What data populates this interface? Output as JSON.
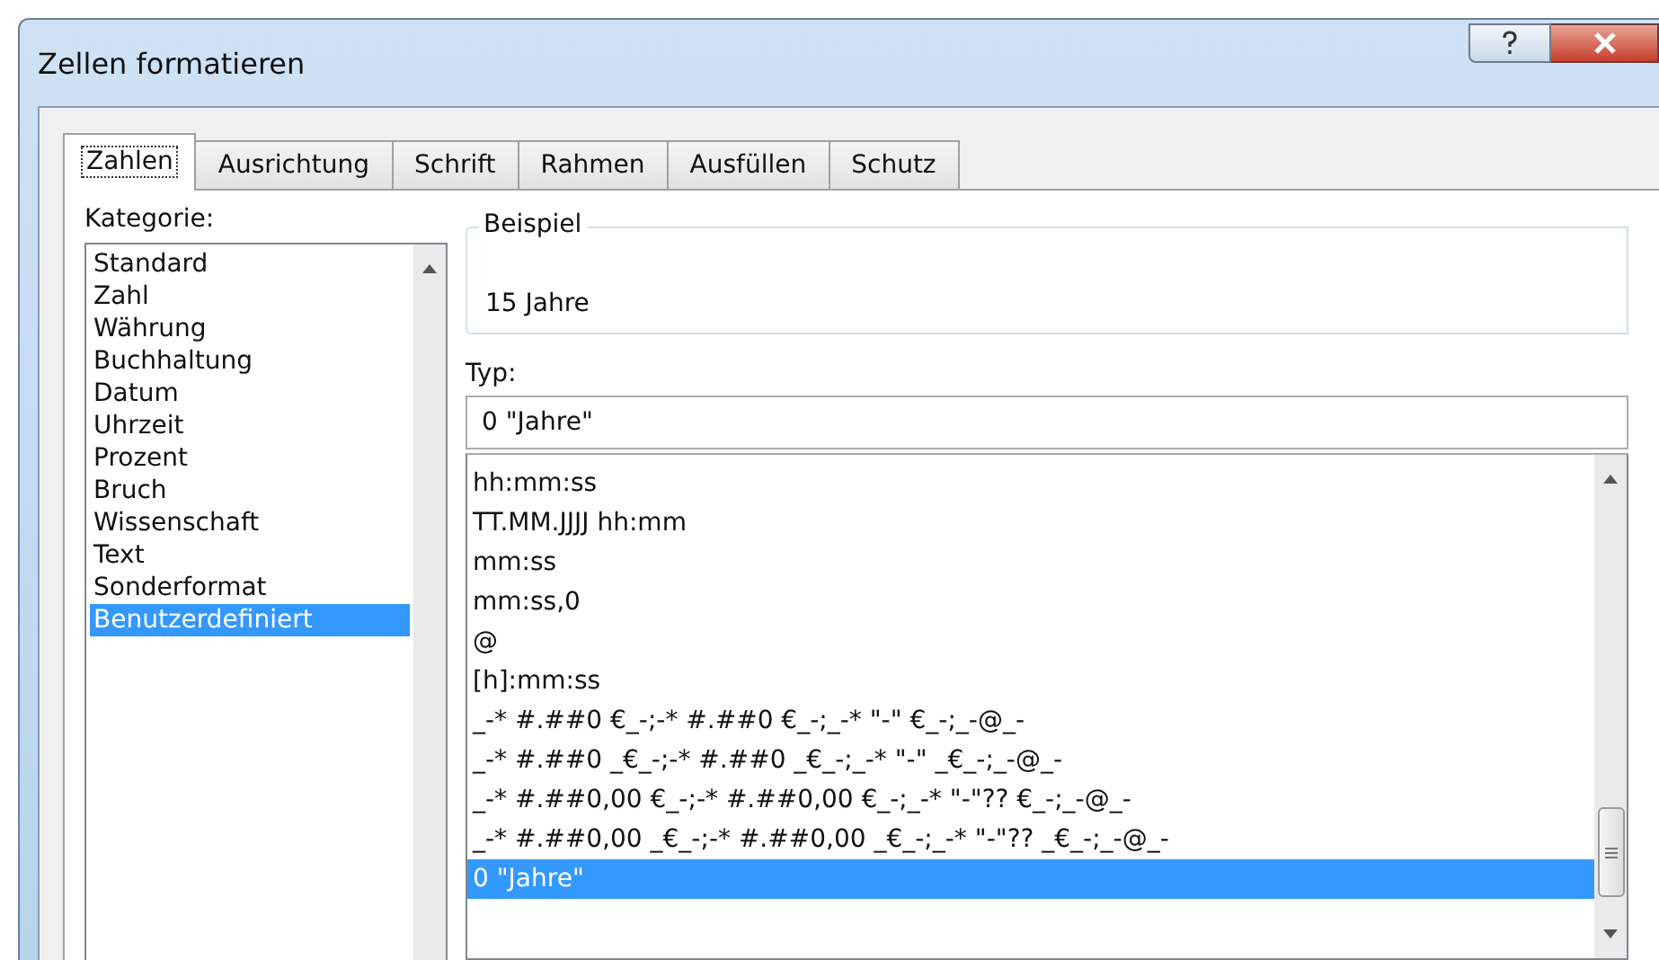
{
  "window": {
    "title": "Zellen formatieren"
  },
  "tabs": [
    {
      "label": "Zahlen",
      "selected": true
    },
    {
      "label": "Ausrichtung",
      "selected": false
    },
    {
      "label": "Schrift",
      "selected": false
    },
    {
      "label": "Rahmen",
      "selected": false
    },
    {
      "label": "Ausfüllen",
      "selected": false
    },
    {
      "label": "Schutz",
      "selected": false
    }
  ],
  "category": {
    "label": "Kategorie:",
    "items": [
      {
        "label": "Standard",
        "selected": false
      },
      {
        "label": "Zahl",
        "selected": false
      },
      {
        "label": "Währung",
        "selected": false
      },
      {
        "label": "Buchhaltung",
        "selected": false
      },
      {
        "label": "Datum",
        "selected": false
      },
      {
        "label": "Uhrzeit",
        "selected": false
      },
      {
        "label": "Prozent",
        "selected": false
      },
      {
        "label": "Bruch",
        "selected": false
      },
      {
        "label": "Wissenschaft",
        "selected": false
      },
      {
        "label": "Text",
        "selected": false
      },
      {
        "label": "Sonderformat",
        "selected": false
      },
      {
        "label": "Benutzerdefiniert",
        "selected": true
      }
    ]
  },
  "sample": {
    "label": "Beispiel",
    "value": "15 Jahre"
  },
  "type": {
    "label": "Typ:",
    "value": "0 \"Jahre\"",
    "formats": [
      {
        "label": "hh:mm:ss",
        "selected": false
      },
      {
        "label": "TT.MM.JJJJ hh:mm",
        "selected": false
      },
      {
        "label": "mm:ss",
        "selected": false
      },
      {
        "label": "mm:ss,0",
        "selected": false
      },
      {
        "label": "@",
        "selected": false
      },
      {
        "label": "[h]:mm:ss",
        "selected": false
      },
      {
        "label": "_-* #.##0 €_-;-* #.##0 €_-;_-* \"-\" €_-;_-@_-",
        "selected": false
      },
      {
        "label": "_-* #.##0 _€_-;-* #.##0 _€_-;_-* \"-\" _€_-;_-@_-",
        "selected": false
      },
      {
        "label": "_-* #.##0,00 €_-;-* #.##0,00 €_-;_-* \"-\"?? €_-;_-@_-",
        "selected": false
      },
      {
        "label": "_-* #.##0,00 _€_-;-* #.##0,00 _€_-;_-* \"-\"?? _€_-;_-@_-",
        "selected": false
      },
      {
        "label": "0 \"Jahre\"",
        "selected": true
      }
    ]
  }
}
